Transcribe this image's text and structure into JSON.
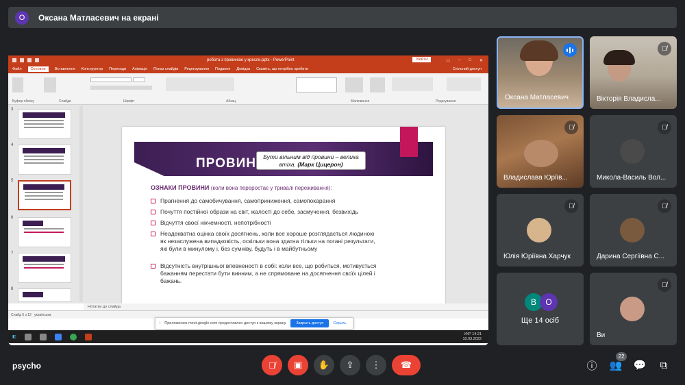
{
  "banner": {
    "avatar_letter": "О",
    "text": "Оксана Матласевич на екрані"
  },
  "ppt": {
    "title": "робота з провиною у кресли.pptx - PowerPoint",
    "signin": "Увійти",
    "tabs": [
      "Файл",
      "Основне",
      "Вставлення",
      "Конструктор",
      "Переходи",
      "Анімація",
      "Показ слайдів",
      "Рецензування",
      "Подання",
      "Довідка",
      "Скажіть, що потрібно зробити"
    ],
    "share": "Спільний доступ",
    "groups": [
      "Буфер обміну",
      "Слайди",
      "Шрифт",
      "Абзац",
      "Малювання",
      "Редагування"
    ],
    "slide_nums": [
      "3",
      "4",
      "5",
      "6",
      "7",
      "8"
    ],
    "notes": "Нотатки до слайда",
    "status": "Слайд 5 з 12",
    "status_lang": "українська",
    "popup": {
      "text": "Приложению meet.google.com предоставлен доступ к вашему экрану.",
      "button": "Закрыть доступ",
      "hide": "Скрыть"
    },
    "clock_time": "14:21",
    "clock_date": "10.03.2022",
    "lang": "УКР"
  },
  "slide": {
    "title": "ПРОВИНА",
    "quote_text": "Бути вільним від провини – велика втіха.",
    "quote_author": "(Марк Цицерон)",
    "subheading": "ОЗНАКИ ПРОВИНИ",
    "subheading_note": "(коли вона переростає у тривалі переживання):",
    "bullets": [
      "Прагнення до самобичування, самоприниження, самопокарання",
      "Почуття постійної образи на світ, жалості до себе, засмучення, безвихідь",
      "Відчуття своєї нікчемності, непотрібності",
      "Неадекватна оцінка своїх досягнень, коли все хороше розглядається людиною як незаслужена випадковість, оскільки вона здатна тільки на погані результати, які були в минулому і, без сумніву, будуть і в майбутньому",
      "Відсутність внутрішньої впевненості в собі: коли все, що робиться, мотивується бажанням перестати бути винним, а не спрямоване на досягнення своїх цілей і бажань."
    ]
  },
  "participants": [
    {
      "name": "Оксана Матласевич"
    },
    {
      "name": "Вікторія Владисла..."
    },
    {
      "name": "Владислава Юріїв..."
    },
    {
      "name": "Микола-Василь Вол..."
    },
    {
      "name": "Юлія Юріївна Харчук"
    },
    {
      "name": "Дарина Сергіївна С..."
    },
    {
      "name": "Ви"
    }
  ],
  "more": {
    "letters": [
      "В",
      "О"
    ],
    "label": "Ще 14 осіб"
  },
  "bottom": {
    "room": "psycho",
    "people_count": "22"
  },
  "colors": {
    "ppt_accent": "#c43e1c",
    "slide_purple": "#3d1e53",
    "slide_pink": "#c2185b",
    "danger": "#ea4335",
    "meet_bg": "#202124"
  }
}
